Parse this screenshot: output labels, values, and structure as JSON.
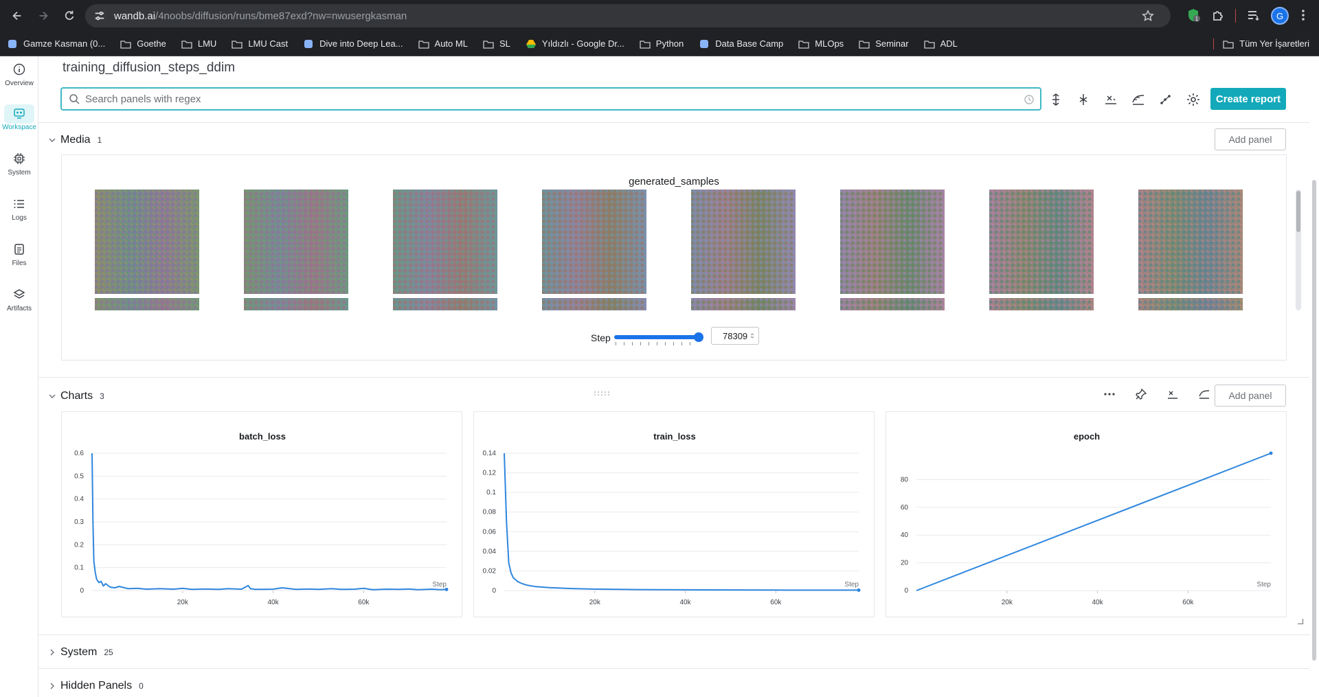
{
  "browser": {
    "url_domain": "wandb.ai",
    "url_path": "/4noobs/diffusion/runs/bme87exd?nw=nwusergkasman",
    "profile_initial": "G",
    "bookmarks": [
      {
        "label": "Gamze Kasman (0...",
        "icon": "site-icon"
      },
      {
        "label": "Goethe",
        "icon": "folder-icon"
      },
      {
        "label": "LMU",
        "icon": "folder-icon"
      },
      {
        "label": "LMU Cast",
        "icon": "folder-icon"
      },
      {
        "label": "Dive into Deep Lea...",
        "icon": "site-icon"
      },
      {
        "label": "Auto ML",
        "icon": "folder-icon"
      },
      {
        "label": "SL",
        "icon": "folder-icon"
      },
      {
        "label": "Yıldızlı - Google Dr...",
        "icon": "drive-icon"
      },
      {
        "label": "Python",
        "icon": "folder-icon"
      },
      {
        "label": "Data Base Camp",
        "icon": "site-icon"
      },
      {
        "label": "MLOps",
        "icon": "folder-icon"
      },
      {
        "label": "Seminar",
        "icon": "folder-icon"
      },
      {
        "label": "ADL",
        "icon": "folder-icon"
      }
    ],
    "bookmarks_all": "Tüm Yer İşaretleri"
  },
  "leftnav": {
    "items": [
      {
        "label": "Overview",
        "icon": "info-icon"
      },
      {
        "label": "Workspace",
        "icon": "workspace-icon"
      },
      {
        "label": "System",
        "icon": "chip-icon"
      },
      {
        "label": "Logs",
        "icon": "list-icon"
      },
      {
        "label": "Files",
        "icon": "file-icon"
      },
      {
        "label": "Artifacts",
        "icon": "layers-icon"
      }
    ],
    "active": "Workspace"
  },
  "main": {
    "run_title": "training_diffusion_steps_ddim",
    "search_placeholder": "Search panels with regex",
    "create_report_label": "Create report"
  },
  "media_section": {
    "title": "Media",
    "count": "1",
    "add_panel_label": "Add panel",
    "panel_title": "generated_samples",
    "image_count": 8,
    "step_label": "Step",
    "step_value": "78309",
    "slider_fraction": 1.0
  },
  "charts_section": {
    "title": "Charts",
    "count": "3",
    "add_panel_label": "Add panel"
  },
  "system_section": {
    "title": "System",
    "count": "25"
  },
  "hidden_section": {
    "title": "Hidden Panels",
    "count": "0"
  },
  "colors": {
    "accent": "#13a9ba",
    "line": "#2e86de",
    "slider": "#1a73e8"
  },
  "chart_data": [
    {
      "type": "line",
      "title": "batch_loss",
      "xlabel": "Step",
      "ylabel": "",
      "xlim": [
        0,
        78309
      ],
      "ylim": [
        0,
        0.6
      ],
      "yticks": [
        0,
        0.1,
        0.2,
        0.3,
        0.4,
        0.5,
        0.6
      ],
      "ytick_labels": [
        "0",
        "0.1",
        "0.2",
        "0.3",
        "0.4",
        "0.5",
        "0.6"
      ],
      "xticks": [
        20000,
        40000,
        60000
      ],
      "xtick_labels": [
        "20k",
        "40k",
        "60k"
      ],
      "series": [
        {
          "x": [
            0,
            200,
            400,
            700,
            1000,
            1500,
            2000,
            2500,
            3000,
            4000,
            5000,
            6000,
            8000,
            10000,
            12000,
            15000,
            18000,
            20000,
            22000,
            25000,
            28000,
            30000,
            33000,
            34500,
            35000,
            36000,
            40000,
            42000,
            45000,
            48000,
            50000,
            53000,
            55000,
            58000,
            60000,
            62000,
            65000,
            68000,
            70000,
            72000,
            75000,
            77000,
            78309
          ],
          "y": [
            0.6,
            0.3,
            0.13,
            0.08,
            0.05,
            0.035,
            0.04,
            0.02,
            0.03,
            0.015,
            0.012,
            0.018,
            0.008,
            0.01,
            0.006,
            0.008,
            0.006,
            0.01,
            0.005,
            0.007,
            0.005,
            0.008,
            0.006,
            0.022,
            0.008,
            0.005,
            0.006,
            0.012,
            0.005,
            0.007,
            0.005,
            0.008,
            0.005,
            0.006,
            0.01,
            0.004,
            0.006,
            0.005,
            0.007,
            0.004,
            0.006,
            0.004,
            0.005
          ]
        }
      ]
    },
    {
      "type": "line",
      "title": "train_loss",
      "xlabel": "Step",
      "ylabel": "",
      "xlim": [
        0,
        78309
      ],
      "ylim": [
        0,
        0.14
      ],
      "yticks": [
        0,
        0.02,
        0.04,
        0.06,
        0.08,
        0.1,
        0.12,
        0.14
      ],
      "ytick_labels": [
        "0",
        "0.02",
        "0.04",
        "0.06",
        "0.08",
        "0.1",
        "0.12",
        "0.14"
      ],
      "xticks": [
        20000,
        40000,
        60000
      ],
      "xtick_labels": [
        "20k",
        "40k",
        "60k"
      ],
      "series": [
        {
          "x": [
            0,
            500,
            1000,
            1500,
            2000,
            3000,
            4000,
            5000,
            7000,
            10000,
            15000,
            20000,
            30000,
            40000,
            50000,
            60000,
            70000,
            78309
          ],
          "y": [
            0.14,
            0.07,
            0.028,
            0.018,
            0.013,
            0.009,
            0.007,
            0.0055,
            0.004,
            0.003,
            0.002,
            0.0015,
            0.001,
            0.0008,
            0.0006,
            0.0005,
            0.0004,
            0.0004
          ]
        }
      ]
    },
    {
      "type": "line",
      "title": "epoch",
      "xlabel": "Step",
      "ylabel": "",
      "xlim": [
        0,
        78309
      ],
      "ylim": [
        0,
        99
      ],
      "yticks": [
        0,
        20,
        40,
        60,
        80
      ],
      "ytick_labels": [
        "0",
        "20",
        "40",
        "60",
        "80"
      ],
      "xticks": [
        20000,
        40000,
        60000
      ],
      "xtick_labels": [
        "20k",
        "40k",
        "60k"
      ],
      "series": [
        {
          "x": [
            0,
            78309
          ],
          "y": [
            0,
            99
          ]
        }
      ]
    }
  ]
}
